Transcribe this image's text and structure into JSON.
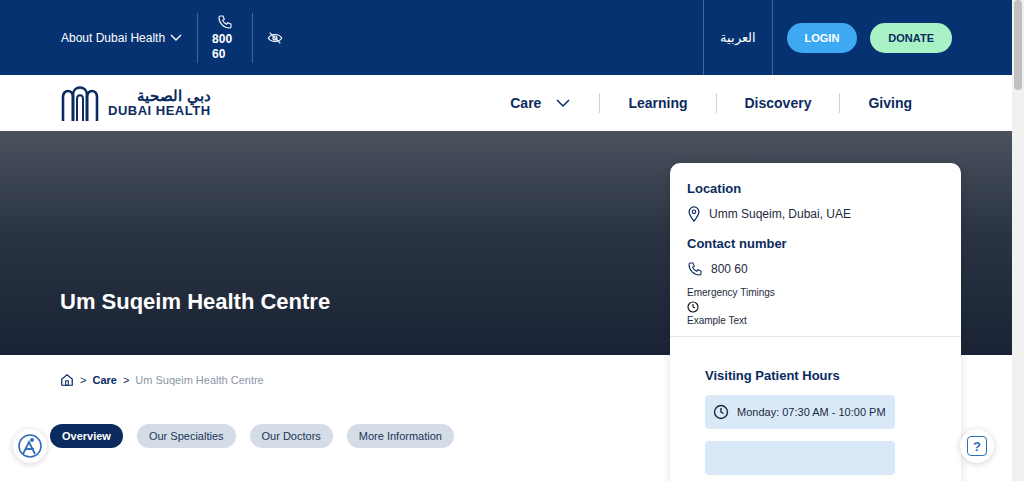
{
  "topbar": {
    "about": "About Dubai Health",
    "phone": "800 60",
    "language": "العربية",
    "login": "LOGIN",
    "donate": "DONATE"
  },
  "logo": {
    "arabic": "دبي الصحية",
    "english": "DUBAI HEALTH"
  },
  "nav": [
    {
      "label": "Care",
      "dropdown": true
    },
    {
      "label": "Learning",
      "dropdown": false
    },
    {
      "label": "Discovery",
      "dropdown": false
    },
    {
      "label": "Giving",
      "dropdown": false
    }
  ],
  "hero": {
    "title": "Um Suqeim Health Centre"
  },
  "breadcrumb": {
    "separator": ">",
    "items": [
      {
        "label": "Care",
        "current": false
      },
      {
        "label": "Um Suqeim Health Centre",
        "current": true
      }
    ]
  },
  "tabs": [
    {
      "label": "Overview",
      "selected": true
    },
    {
      "label": "Our Specialties",
      "selected": false
    },
    {
      "label": "Our Doctors",
      "selected": false
    },
    {
      "label": "More Information",
      "selected": false
    }
  ],
  "info_card": {
    "location_label": "Location",
    "location": "Umm Suqeim, Dubai, UAE",
    "contact_label": "Contact number",
    "contact": "800 60",
    "emergency_label": "Emergency Timings",
    "emergency": "Example Text"
  },
  "visiting": {
    "title": "Visiting Patient Hours",
    "hours": [
      "Monday: 07:30 AM - 10:00 PM"
    ]
  },
  "help": "?"
}
